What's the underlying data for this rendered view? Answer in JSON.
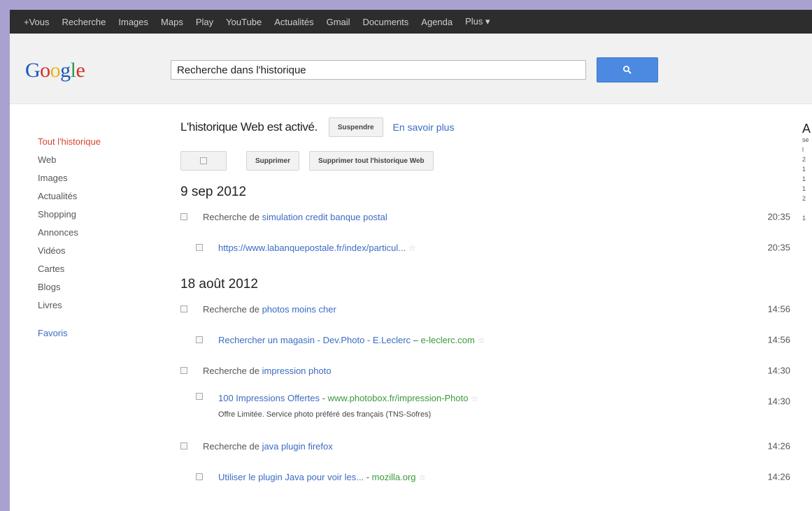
{
  "topbar": {
    "items": [
      "+Vous",
      "Recherche",
      "Images",
      "Maps",
      "Play",
      "YouTube",
      "Actualités",
      "Gmail",
      "Documents",
      "Agenda",
      "Plus ▾"
    ]
  },
  "header": {
    "logo": "Google",
    "search_value": "Recherche dans l'historique",
    "search_icon": "search-icon"
  },
  "sidebar": {
    "items": [
      "Tout l'historique",
      "Web",
      "Images",
      "Actualités",
      "Shopping",
      "Annonces",
      "Vidéos",
      "Cartes",
      "Blogs",
      "Livres"
    ],
    "favorites": "Favoris"
  },
  "main": {
    "status_text": "L'historique Web est activé.",
    "suspend_label": "Suspendre",
    "learn_more": "En savoir plus",
    "delete_label": "Supprimer",
    "delete_all_label": "Supprimer tout l'historique Web",
    "groups": [
      {
        "date": "9 sep 2012",
        "entries": [
          {
            "prefix": "Recherche de ",
            "query": "simulation credit banque postal",
            "time": "20:35"
          },
          {
            "link": "https://www.labanquepostale.fr/index/particul...",
            "star": "☆",
            "time": "20:35"
          }
        ]
      },
      {
        "date": "18 août 2012",
        "entries": [
          {
            "prefix": "Recherche de ",
            "query": "photos moins cher",
            "time": "14:56"
          },
          {
            "link": "Rechercher un magasin - Dev.Photo - E.Leclerc",
            "sep": " – ",
            "site": "e-leclerc.com",
            "star": "☆",
            "time": "14:56"
          },
          {
            "prefix": "Recherche de ",
            "query": "impression photo",
            "time": "14:30"
          },
          {
            "link": "100 Impressions Offertes",
            "sep": " - ",
            "site": "www.photobox.fr/impression-Photo",
            "star": "☆",
            "snippet": "Offre Limitée. Service photo préféré des français (TNS-Sofres)",
            "time": "14:30"
          },
          {
            "prefix": "Recherche de ",
            "query": "java plugin firefox",
            "time": "14:26"
          },
          {
            "link": "Utiliser le plugin Java pour voir les...",
            "sep": " - ",
            "site": "mozilla.org",
            "star": "☆",
            "time": "14:26"
          }
        ]
      }
    ]
  },
  "right_panel": {
    "heading": "A",
    "lines": [
      "se",
      "l",
      "2",
      "1",
      "1",
      "1",
      "2",
      "",
      "1"
    ]
  },
  "colors": {
    "topbar": "#2d2d2d",
    "search_button": "#4b8ae0",
    "link": "#3b6bc4",
    "site": "#3a9a3a",
    "active_sidebar": "#d64633"
  }
}
